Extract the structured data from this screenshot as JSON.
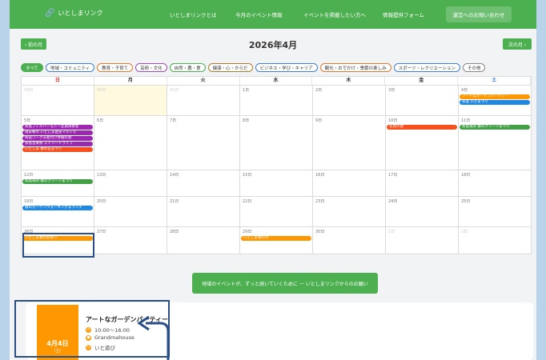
{
  "nav": {
    "logo": "いとしまリンク",
    "items": [
      "いとしまリンクとは",
      "今月のイベント情報",
      "イベントを掲載したい方へ",
      "情報提供フォーム"
    ],
    "contact": "運営へのお問い合わせ"
  },
  "calendar": {
    "title": "2026年4月",
    "prev": "‹ 前の月",
    "next": "次の月 ›",
    "categories": [
      "すべて",
      "地域・コミュニティ",
      "教育・子育て",
      "芸術・文化",
      "自然・農・食",
      "健康・心・からだ",
      "ビジネス・学び・キャリア",
      "観光・おでかけ・季節の楽しみ",
      "スポーツ・レクリエーション",
      "その他"
    ],
    "weekdays": [
      "日",
      "月",
      "火",
      "水",
      "木",
      "金",
      "土"
    ],
    "weeks": [
      [
        {
          "d": "29日"
        },
        {
          "d": "30日"
        },
        {
          "d": "31日"
        },
        {
          "d": "1日"
        },
        {
          "d": "2日"
        },
        {
          "d": "3日"
        },
        {
          "d": "4日",
          "ev": [
            {
              "t": "アートなガーデンパーティー",
              "c": "#ff9800"
            },
            {
              "t": "糸島 小さまつり",
              "c": "#1e88e5"
            }
          ]
        }
      ],
      [
        {
          "d": "5日",
          "ev": [
            {
              "t": "糸島フィルハーモニー定期演奏会",
              "c": "#9c27b0"
            },
            {
              "t": "週末朝市 いとしま直売マルシェ",
              "c": "#9c27b0"
            },
            {
              "t": "陶芸ワーク＆絵付け体験の会",
              "c": "#9c27b0"
            },
            {
              "t": "糸島音楽祭 ストリートライブ",
              "c": "#9c27b0"
            },
            {
              "t": "いとしま 春の花まつり",
              "c": "#f4511e"
            }
          ]
        },
        {
          "d": "6日"
        },
        {
          "d": "7日"
        },
        {
          "d": "8日"
        },
        {
          "d": "9日"
        },
        {
          "d": "10日",
          "ev": [
            {
              "t": "花見の会",
              "c": "#f4511e"
            }
          ]
        },
        {
          "d": "11日",
          "ev": [
            {
              "t": "糸島海岸 春のクリーンまつり",
              "c": "#43a047"
            }
          ]
        }
      ],
      [
        {
          "d": "12日",
          "ev": [
            {
              "t": "糸島海岸 春のクリーンまつり",
              "c": "#43a047"
            }
          ]
        },
        {
          "d": "13日"
        },
        {
          "d": "14日"
        },
        {
          "d": "15日"
        },
        {
          "d": "16日"
        },
        {
          "d": "17日"
        },
        {
          "d": "18日"
        }
      ],
      [
        {
          "d": "19日",
          "ev": [
            {
              "t": "春のガーデンウォーキング＆ランチ",
              "c": "#1e88e5"
            }
          ]
        },
        {
          "d": "20日"
        },
        {
          "d": "21日"
        },
        {
          "d": "22日"
        },
        {
          "d": "23日"
        },
        {
          "d": "24日"
        },
        {
          "d": "25日"
        }
      ],
      [
        {
          "d": "26日",
          "ev": [
            {
              "t": "いとしま春のお祭り",
              "c": "#ff9800"
            }
          ]
        },
        {
          "d": "27日"
        },
        {
          "d": "28日"
        },
        {
          "d": "29日",
          "ev": [
            {
              "t": "いとしま春の市",
              "c": "#ff9800"
            }
          ]
        },
        {
          "d": "30日"
        },
        {
          "d": "1日"
        },
        {
          "d": "2日"
        }
      ]
    ]
  },
  "cta": "地域のイベントが、ずっと続いていくために ー いとしまリンクからのお願い",
  "event_card": {
    "date": "4月4日",
    "weekday": "（土）",
    "title": "アートなガーデンパーティー",
    "time": "10:00〜16:00",
    "place": "Grandmahouse",
    "tag": "いと遊び"
  }
}
